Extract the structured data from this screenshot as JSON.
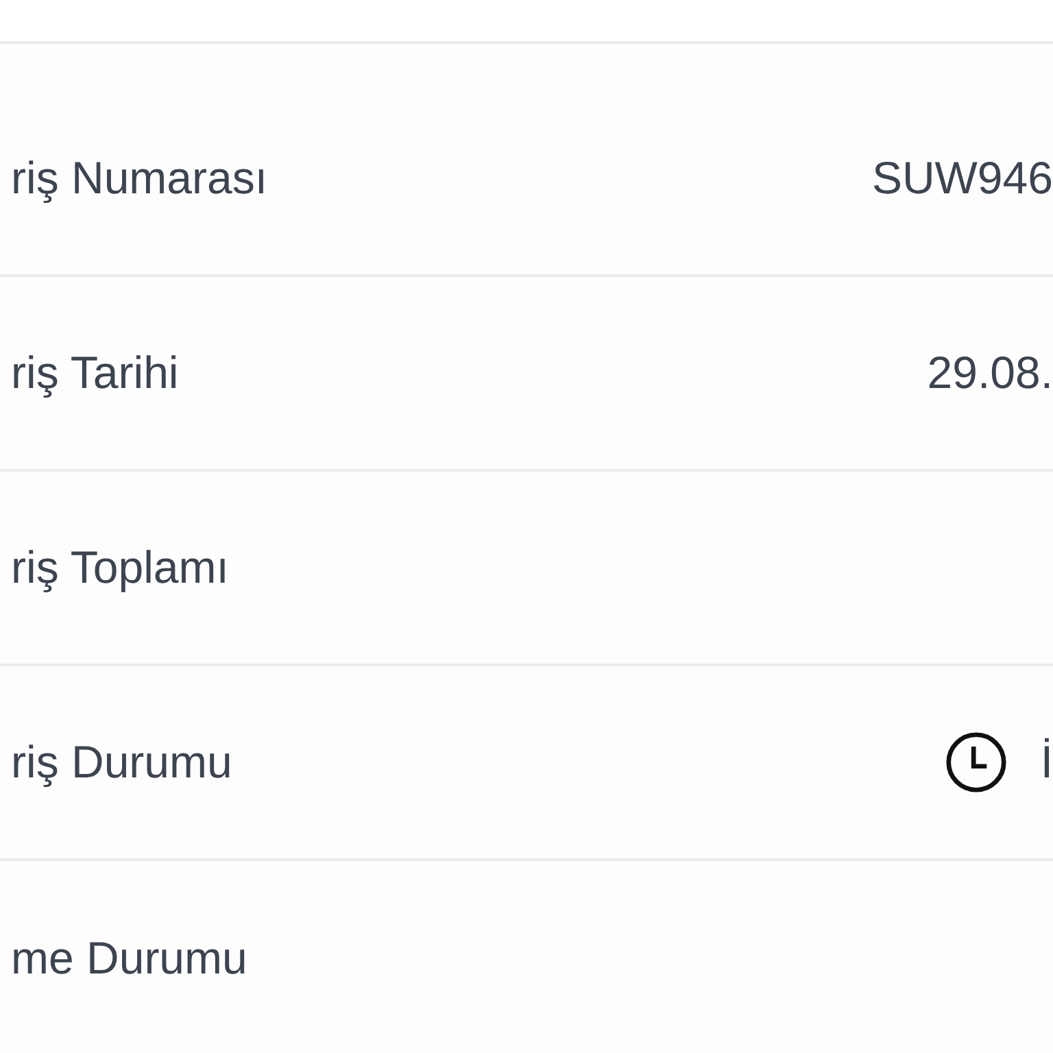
{
  "rows": [
    {
      "label": "riş Numarası",
      "value": "SUW946"
    },
    {
      "label": "riş Tarihi",
      "value": "29.08."
    },
    {
      "label": "riş Toplamı"
    },
    {
      "label": "riş Durumu",
      "value": "İ",
      "kind": "status"
    },
    {
      "label": "me Durumu"
    }
  ]
}
